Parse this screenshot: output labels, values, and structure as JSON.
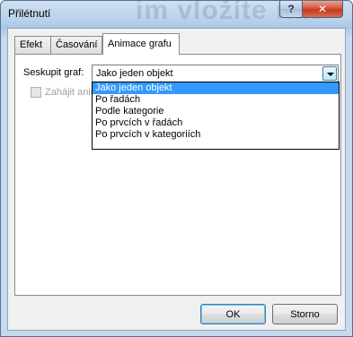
{
  "window": {
    "title": "Přilétnutí",
    "background_watermark": "im vložíte naš",
    "help_label": "?",
    "close_label": "✕"
  },
  "tabs": [
    {
      "label": "Efekt",
      "active": false
    },
    {
      "label": "Časování",
      "active": false
    },
    {
      "label": "Animace grafu",
      "active": true
    }
  ],
  "group_chart": {
    "label": "Seskupit graf:",
    "selected": "Jako jeden objekt",
    "options": [
      "Jako jeden objekt",
      "Po řadách",
      "Podle kategorie",
      "Po prvcích v řadách",
      "Po prvcích v kategoriích"
    ]
  },
  "start_animation": {
    "label": "Zahájit anim",
    "checked": false,
    "disabled": true
  },
  "buttons": {
    "ok": "OK",
    "cancel": "Storno"
  },
  "colors": {
    "selection": "#3399ff",
    "close_button": "#c23a20",
    "dialog_bg": "#f0f0f0"
  }
}
